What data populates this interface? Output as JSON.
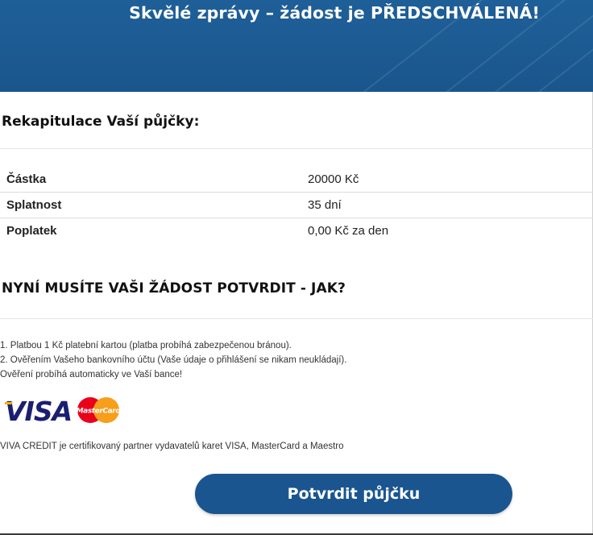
{
  "hero": {
    "title": "Skvělé zprávy – žádost je PŘEDSCHVÁLENÁ!",
    "background_color": "#1f5f98"
  },
  "summary": {
    "title": "Rekapitulace Vaší půjčky:",
    "rows": [
      {
        "label": "Částka",
        "value": "20000 Kč"
      },
      {
        "label": "Splatnost",
        "value": "35 dní"
      },
      {
        "label": "Poplatek",
        "value": "0,00 Kč za den"
      }
    ]
  },
  "confirm": {
    "title": "NYNÍ MUSÍTE VAŠI ŽÁDOST POTVRDIT - JAK?",
    "steps": [
      "1. Platbou 1 Kč platební kartou (platba probíhá zabezpečenou bránou).",
      "2. Ověřením Vašeho bankovního účtu (Vaše údaje o přihlášení se nikam neukládají).",
      "Ověření probíhá automaticky ve Vaší bance!"
    ]
  },
  "payment_logos": {
    "visa_text": "VISA",
    "mastercard_text": "MasterCard",
    "visa_color": "#1a1f71",
    "mastercard_red": "#eb001b",
    "mastercard_orange": "#f79e1b"
  },
  "partner_text": "VIVA CREDIT je certifikovaný partner vydavatelů karet VISA, MasterCard a Maestro",
  "cta": {
    "label": "Potvrdit půjčku",
    "color": "#1a5590"
  }
}
